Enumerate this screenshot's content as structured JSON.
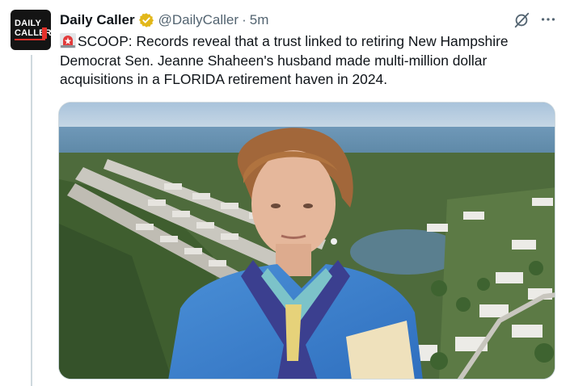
{
  "tweet": {
    "author_name": "Daily Caller",
    "handle": "@DailyCaller",
    "separator": "·",
    "time": "5m",
    "text": "SCOOP: Records reveal that a trust linked to retiring New Hampshire Democrat Sen. Jeanne Shaheen's husband made multi-million dollar acquisitions in a FLORIDA retirement haven in 2024.",
    "lead_emoji": "siren-icon"
  },
  "avatar": {
    "logo_line1": "DAILY",
    "logo_line2": "CALLER"
  },
  "icons": {
    "verified": "gold-verified-badge-icon",
    "grok": "grok-icon",
    "more": "more-options-icon"
  },
  "colors": {
    "text": "#0f1419",
    "secondary_text": "#536471",
    "verified_gold": "#e2b719",
    "thread_line": "#cfd9de",
    "logo_red": "#e4312b"
  }
}
